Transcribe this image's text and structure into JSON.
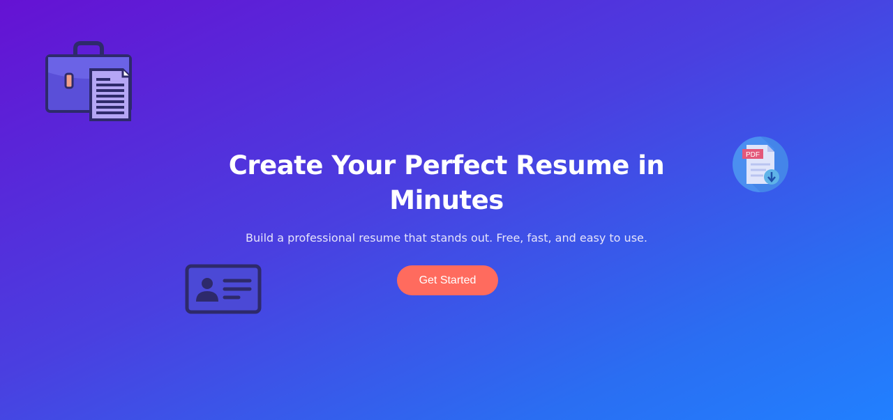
{
  "hero": {
    "title": "Create Your Perfect Resume in Minutes",
    "subtitle": "Build a professional resume that stands out. Free, fast, and easy to use.",
    "cta_label": "Get Started"
  },
  "decorations": {
    "pdf_label": "PDF",
    "icons": [
      "briefcase-document-icon",
      "pdf-download-icon",
      "id-card-icon"
    ]
  },
  "colors": {
    "gradient_start": "#6512d3",
    "gradient_end": "#2180ff",
    "cta_background": "#ff6b5e",
    "text": "#ffffff"
  }
}
